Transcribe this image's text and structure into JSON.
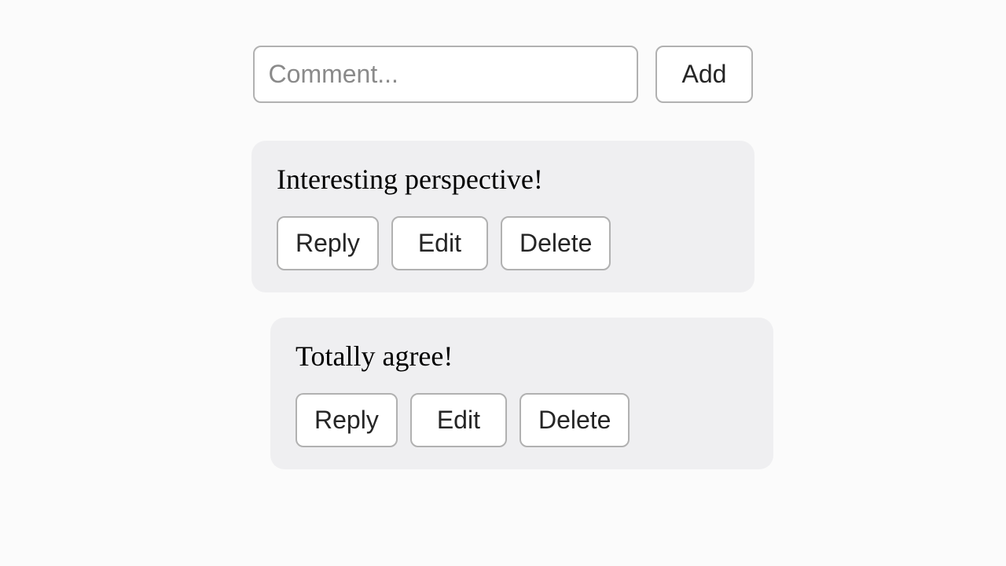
{
  "composer": {
    "placeholder": "Comment...",
    "value": "",
    "add_label": "Add"
  },
  "buttons": {
    "reply": "Reply",
    "edit": "Edit",
    "delete": "Delete"
  },
  "comments": {
    "0": {
      "text": "Interesting perspective!"
    },
    "1": {
      "text": "Totally agree!"
    }
  }
}
